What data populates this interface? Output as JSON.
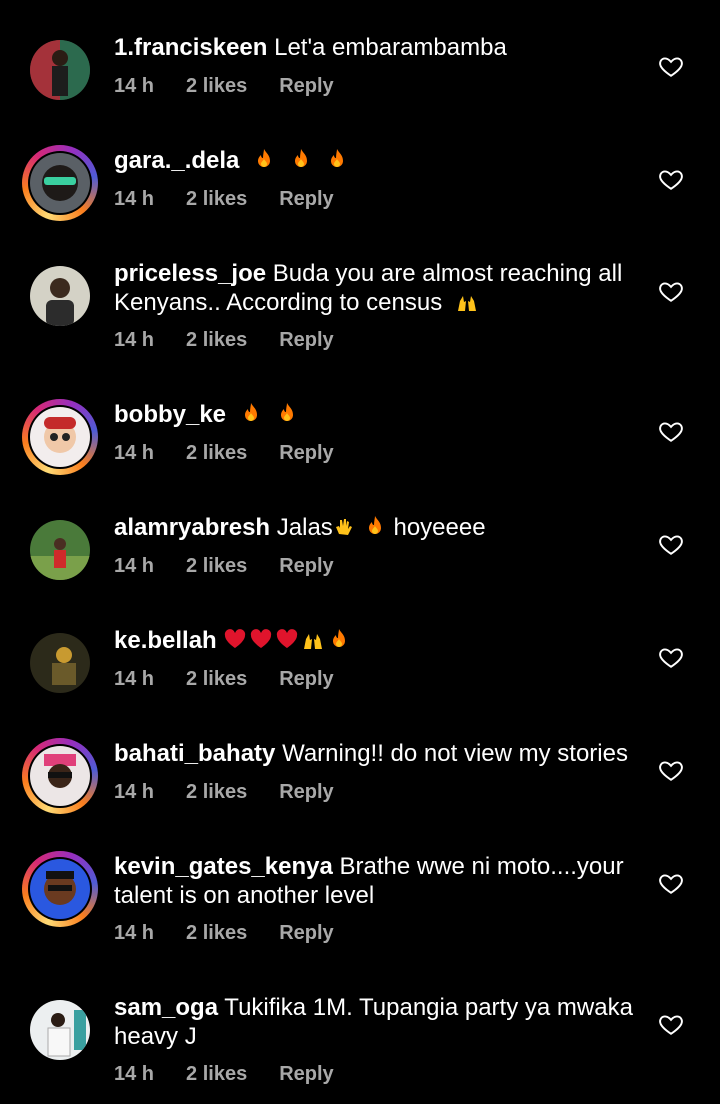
{
  "comments": [
    {
      "user": "1.franciskeen",
      "text": "Let'a embarambamba",
      "time": "14 h",
      "likes": "2 likes",
      "reply": "Reply",
      "emojis": []
    },
    {
      "user": "gara._.dela",
      "text": "",
      "time": "14 h",
      "likes": "2 likes",
      "reply": "Reply",
      "emojis": [
        "fire",
        "fire",
        "fire"
      ]
    },
    {
      "user": "priceless_joe",
      "text": "Buda you are almost reaching all Kenyans.. According to census",
      "time": "14 h",
      "likes": "2 likes",
      "reply": "Reply",
      "emojis": [
        "raised-hands"
      ]
    },
    {
      "user": "bobby_ke",
      "text": "",
      "time": "14 h",
      "likes": "2 likes",
      "reply": "Reply",
      "emojis": [
        "fire",
        "fire"
      ]
    },
    {
      "user": "alamryabresh",
      "text": "Jalas",
      "text2": "hoyeeee",
      "time": "14 h",
      "likes": "2 likes",
      "reply": "Reply",
      "emojis": [
        "clap",
        "fire"
      ]
    },
    {
      "user": "ke.bellah",
      "text": "",
      "time": "14 h",
      "likes": "2 likes",
      "reply": "Reply",
      "emojis": [
        "heart",
        "heart",
        "heart",
        "raised-hands",
        "fire"
      ]
    },
    {
      "user": "bahati_bahaty",
      "text": "Warning!! do not view my stories",
      "time": "14 h",
      "likes": "2 likes",
      "reply": "Reply",
      "emojis": []
    },
    {
      "user": "kevin_gates_kenya",
      "text": "Brathe wwe ni moto....your talent is on another level",
      "time": "14 h",
      "likes": "2 likes",
      "reply": "Reply",
      "emojis": []
    },
    {
      "user": "sam_oga",
      "text": "Tukifika 1M.  Tupangia party ya mwaka heavy J",
      "time": "14 h",
      "likes": "2 likes",
      "reply": "Reply",
      "emojis": []
    }
  ],
  "icons": {
    "like": "heart-outline-icon"
  },
  "colors": {
    "background": "#000000",
    "meta": "#a8a8a8",
    "emoji_fire": "#ff7a00",
    "emoji_heart": "#e0142c",
    "emoji_yellow": "#ffc21a"
  }
}
